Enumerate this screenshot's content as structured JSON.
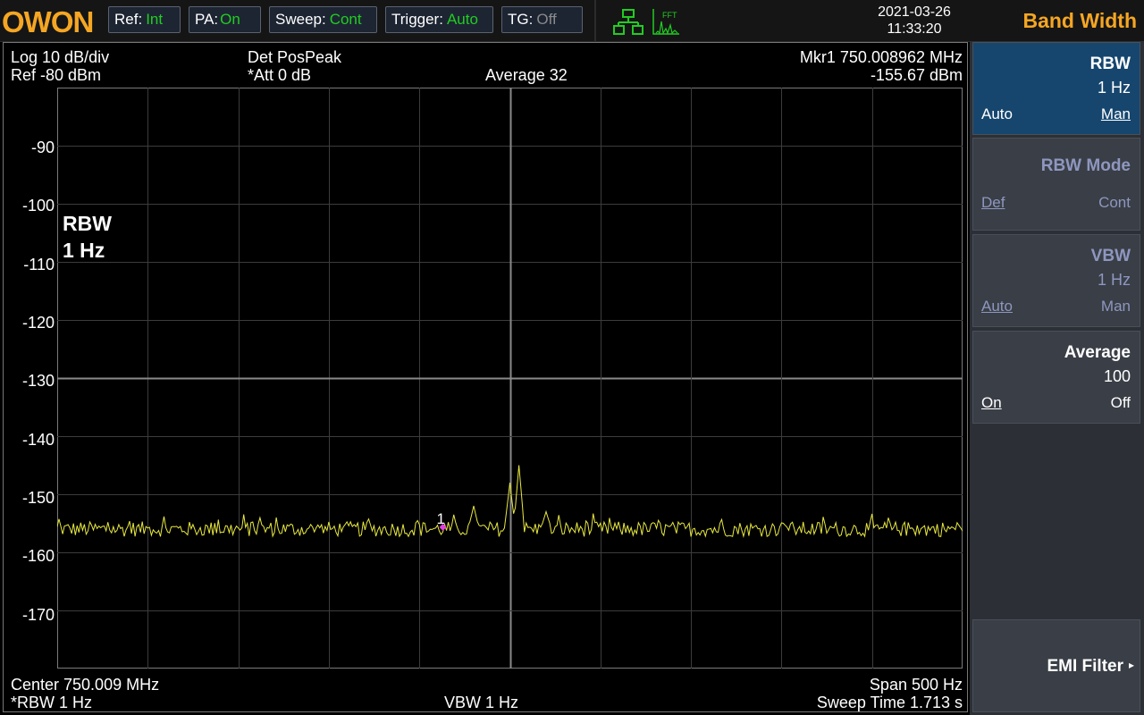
{
  "header": {
    "logo_text": "OWON",
    "ref": {
      "label": "Ref:",
      "value": "Int"
    },
    "pa": {
      "label": "PA:",
      "value": "On"
    },
    "sweep": {
      "label": "Sweep:",
      "value": "Cont"
    },
    "trigger": {
      "label": "Trigger:",
      "value": "Auto"
    },
    "tg": {
      "label": "TG:",
      "value": "Off"
    },
    "date": "2021-03-26",
    "time": "11:33:20",
    "icons": [
      "network-icon",
      "fft-icon"
    ],
    "fft_icon_text": "FFT"
  },
  "screen": {
    "scale": "Log 10 dB/div",
    "ref_level": "Ref -80 dBm",
    "detector": "Det PosPeak",
    "attenuation": "*Att 0 dB",
    "average": "Average 32",
    "marker_freq": "Mkr1  750.008962 MHz",
    "marker_level": "-155.67 dBm",
    "overlay_line1": "RBW",
    "overlay_line2": "1 Hz",
    "center": "Center 750.009 MHz",
    "rbw": "*RBW 1 Hz",
    "vbw": "VBW 1 Hz",
    "span": "Span 500 Hz",
    "sweep_time": "Sweep Time 1.713 s",
    "y_labels": [
      "-90",
      "-100",
      "-110",
      "-120",
      "-130",
      "-140",
      "-150",
      "-160",
      "-170"
    ],
    "marker_label": "1"
  },
  "chart_data": {
    "type": "line",
    "xlabel": "",
    "ylabel": "",
    "x_range_hz_offset": [
      -250,
      250
    ],
    "ylim": [
      -180,
      -80
    ],
    "noise_floor_dbm": -156,
    "peaks": [
      {
        "offset_hz": -20,
        "level_dbm": -152
      },
      {
        "offset_hz": 0,
        "level_dbm": -148
      },
      {
        "offset_hz": 5,
        "level_dbm": -145
      },
      {
        "offset_hz": 20,
        "level_dbm": -153
      },
      {
        "offset_hz": 151,
        "level_dbm": -155
      }
    ],
    "marker": {
      "label": "1",
      "offset_hz": -37,
      "level_dbm": -155.67
    },
    "trace_color": "#e8e840",
    "marker_color": "#e040e0",
    "grid": true
  },
  "panel": {
    "title": "Band Width",
    "rbw": {
      "title": "RBW",
      "value": "1 Hz",
      "left": "Auto",
      "right": "Man"
    },
    "rbw_mode": {
      "title": "RBW Mode",
      "left": "Def",
      "right": "Cont"
    },
    "vbw": {
      "title": "VBW",
      "value": "1 Hz",
      "left": "Auto",
      "right": "Man"
    },
    "average": {
      "title": "Average",
      "value": "100",
      "left": "On",
      "right": "Off"
    },
    "emi_filter": {
      "title": "EMI Filter",
      "arrow": "▸"
    }
  },
  "colors": {
    "accent": "#f5a623",
    "status_on": "#22cc22",
    "status_off": "#8a8a8a",
    "active_key": "#16466e"
  }
}
